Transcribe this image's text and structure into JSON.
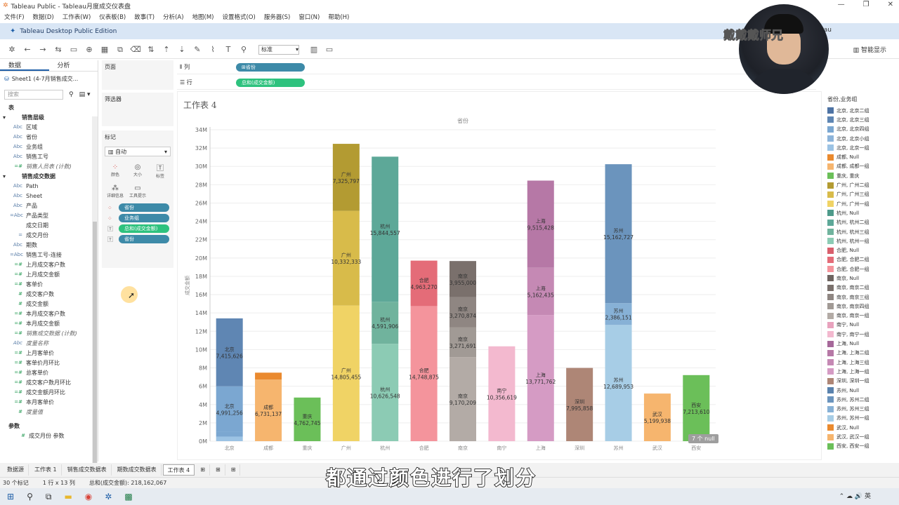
{
  "window": {
    "title": "Tableau Public - Tableau月度成交仪表盘"
  },
  "menu": [
    "文件(F)",
    "数据(D)",
    "工作表(W)",
    "仪表板(B)",
    "故事(T)",
    "分析(A)",
    "地图(M)",
    "设置格式(O)",
    "服务器(S)",
    "窗口(N)",
    "帮助(H)"
  ],
  "edition": "Tableau Desktop Public Edition",
  "signin": "Tableau",
  "toolbar": {
    "fit": "标准",
    "smart_show": "智能显示"
  },
  "left": {
    "tabs": [
      "数据",
      "分析"
    ],
    "datasource": "Sheet1 (4-7月销售成交...",
    "search_placeholder": "搜索",
    "table_header": "表",
    "fields": [
      {
        "type": "",
        "label": "销售层级",
        "group": true
      },
      {
        "type": "Abc",
        "label": "区域"
      },
      {
        "type": "Abc",
        "label": "省份"
      },
      {
        "type": "Abc",
        "label": "业务组"
      },
      {
        "type": "Abc",
        "label": "销售工号"
      },
      {
        "type": "=#",
        "label": "销售人员表 (计数)",
        "italic": true
      },
      {
        "type": "",
        "label": "销售成交数据",
        "group": true
      },
      {
        "type": "Abc",
        "label": "Path"
      },
      {
        "type": "Abc",
        "label": "Sheet"
      },
      {
        "type": "Abc",
        "label": "产品"
      },
      {
        "type": "=Abc",
        "label": "产品类型"
      },
      {
        "type": "",
        "label": "成交日期"
      },
      {
        "type": "=",
        "label": "成交月份"
      },
      {
        "type": "Abc",
        "label": "期数"
      },
      {
        "type": "=Abc",
        "label": "销售工号-连接"
      },
      {
        "type": "=#",
        "label": "上月成交客户数"
      },
      {
        "type": "=#",
        "label": "上月成交金额"
      },
      {
        "type": "=#",
        "label": "客单价"
      },
      {
        "type": "#",
        "label": "成交客户数"
      },
      {
        "type": "#",
        "label": "成交金额"
      },
      {
        "type": "=#",
        "label": "本月成交客户数"
      },
      {
        "type": "=#",
        "label": "本月成交金额"
      },
      {
        "type": "=#",
        "label": "销售成交数据 (计数)",
        "italic": true
      },
      {
        "type": "Abc",
        "label": "度量名称",
        "italic": true
      },
      {
        "type": "=#",
        "label": "上月客单价"
      },
      {
        "type": "=#",
        "label": "客单价月环比"
      },
      {
        "type": "=#",
        "label": "总客单价"
      },
      {
        "type": "=#",
        "label": "成交客户数月环比"
      },
      {
        "type": "=#",
        "label": "成交金额月环比"
      },
      {
        "type": "=#",
        "label": "本月客单价"
      },
      {
        "type": "#",
        "label": "度量值",
        "italic": true
      }
    ],
    "params_header": "参数",
    "param": "成交月份 参数"
  },
  "cards": {
    "pages": "页面",
    "filters": "筛选器",
    "marks": "标记",
    "mark_type": "自动",
    "buttons": [
      "颜色",
      "大小",
      "标签",
      "详细信息",
      "工具提示"
    ],
    "pills": [
      {
        "label": "省份",
        "kind": "blue",
        "icon": "color"
      },
      {
        "label": "业务组",
        "kind": "blue",
        "icon": "color"
      },
      {
        "label": "总和(成交金额)",
        "kind": "green",
        "icon": "label"
      },
      {
        "label": "省份",
        "kind": "blue",
        "icon": "label"
      }
    ]
  },
  "shelves": {
    "columns_label": "列",
    "columns_pill": "省份",
    "rows_label": "行",
    "rows_pill": "总和(成交金额)"
  },
  "view": {
    "title": "工作表 4",
    "null_badge": "7 个 null"
  },
  "chart_data": {
    "type": "bar",
    "stacked": true,
    "title": "",
    "xlabel": "省份",
    "ylabel": "成交金额",
    "ylim": [
      0,
      34000000
    ],
    "yticks": [
      "0M",
      "2M",
      "4M",
      "6M",
      "8M",
      "10M",
      "12M",
      "14M",
      "16M",
      "18M",
      "20M",
      "22M",
      "24M",
      "26M",
      "28M",
      "30M",
      "32M",
      "34M"
    ],
    "categories": [
      "北京",
      "成都",
      "重庆",
      "广州",
      "杭州",
      "合肥",
      "南京",
      "南宁",
      "上海",
      "深圳",
      "苏州",
      "武汉",
      "西安"
    ],
    "bars": [
      {
        "category": "北京",
        "segments": [
          {
            "value": 500000,
            "color": "#9cc3e4"
          },
          {
            "value": 500000,
            "color": "#7ba7d1"
          },
          {
            "value": 4991256,
            "color": "#7ba7d1",
            "label": "北京\n4,991,256"
          },
          {
            "value": 7415626,
            "color": "#5f86b3",
            "label": "北京\n7,415,626"
          }
        ]
      },
      {
        "category": "成都",
        "segments": [
          {
            "value": 6731137,
            "color": "#f6b56e",
            "label": "成都\n6,731,137"
          },
          {
            "value": 750000,
            "color": "#ea8a2f"
          }
        ]
      },
      {
        "category": "重庆",
        "segments": [
          {
            "value": 4762745,
            "color": "#6bbf59",
            "label": "重庆\n4,762,745"
          }
        ]
      },
      {
        "category": "广州",
        "segments": [
          {
            "value": 14805455,
            "color": "#f0d365",
            "label": "广州\n14,805,455"
          },
          {
            "value": 10332333,
            "color": "#d8bb4a",
            "label": "广州\n10,332,333"
          },
          {
            "value": 7325797,
            "color": "#b39b32",
            "label": "广州\n7,325,797"
          }
        ]
      },
      {
        "category": "杭州",
        "segments": [
          {
            "value": 10626548,
            "color": "#8ccbb4",
            "label": "杭州\n10,626,548"
          },
          {
            "value": 4591906,
            "color": "#70b39d",
            "label": "杭州\n4,591,906"
          },
          {
            "value": 15844557,
            "color": "#5da898",
            "label": "杭州\n15,844,557"
          }
        ]
      },
      {
        "category": "合肥",
        "segments": [
          {
            "value": 14748875,
            "color": "#f4949c",
            "label": "合肥\n14,748,875"
          },
          {
            "value": 4963270,
            "color": "#e46c78",
            "label": "合肥\n4,963,270"
          }
        ]
      },
      {
        "category": "南京",
        "segments": [
          {
            "value": 9170209,
            "color": "#b3aba6",
            "label": "南京\n9,170,209"
          },
          {
            "value": 3271691,
            "color": "#a19a95",
            "label": "南京\n3,271,691"
          },
          {
            "value": 3270874,
            "color": "#8f8682",
            "label": "南京\n3,270,874"
          },
          {
            "value": 3955000,
            "color": "#7a706c",
            "label": "南京\n3,955,000"
          }
        ]
      },
      {
        "category": "南宁",
        "segments": [
          {
            "value": 10356619,
            "color": "#f3b9cf",
            "label": "南宁\n10,356,619"
          }
        ]
      },
      {
        "category": "上海",
        "segments": [
          {
            "value": 13771762,
            "color": "#d59bc4",
            "label": "上海\n13,771,762"
          },
          {
            "value": 5162435,
            "color": "#c589b4",
            "label": "上海\n5,162,435"
          },
          {
            "value": 9515428,
            "color": "#b678a6",
            "label": "上海\n9,515,428"
          }
        ]
      },
      {
        "category": "深圳",
        "segments": [
          {
            "value": 7995858,
            "color": "#ae8676",
            "label": "深圳\n7,995,858"
          }
        ]
      },
      {
        "category": "苏州",
        "segments": [
          {
            "value": 12689953,
            "color": "#a7cde6",
            "label": "苏州\n12,689,953"
          },
          {
            "value": 2386151,
            "color": "#87b1d6",
            "label": "苏州\n2,386,151"
          },
          {
            "value": 15162727,
            "color": "#6b94bd",
            "label": "苏州\n15,162,727"
          }
        ]
      },
      {
        "category": "武汉",
        "segments": [
          {
            "value": 5199938,
            "color": "#f6b56e",
            "label": "武汉\n5,199,938"
          }
        ]
      },
      {
        "category": "西安",
        "segments": [
          {
            "value": 7213610,
            "color": "#6bbf59",
            "label": "西安\n7,213,610"
          }
        ]
      }
    ],
    "legend": {
      "title": "省份,业务组",
      "items": [
        {
          "label": "北京, 北京二组",
          "color": "#4e73a4"
        },
        {
          "label": "北京, 北京三组",
          "color": "#5f86b3"
        },
        {
          "label": "北京, 北京四组",
          "color": "#7ba7d1"
        },
        {
          "label": "北京, 北京小组",
          "color": "#8db4da"
        },
        {
          "label": "北京, 北京一组",
          "color": "#9cc3e4"
        },
        {
          "label": "成都, Null",
          "color": "#ea8a2f"
        },
        {
          "label": "成都, 成都一组",
          "color": "#f6b56e"
        },
        {
          "label": "重庆, 重庆",
          "color": "#6bbf59"
        },
        {
          "label": "广州, 广州二组",
          "color": "#b39b32"
        },
        {
          "label": "广州, 广州三组",
          "color": "#d8bb4a"
        },
        {
          "label": "广州, 广州一组",
          "color": "#f0d365"
        },
        {
          "label": "杭州, Null",
          "color": "#4e9a8a"
        },
        {
          "label": "杭州, 杭州二组",
          "color": "#5da898"
        },
        {
          "label": "杭州, 杭州三组",
          "color": "#70b39d"
        },
        {
          "label": "杭州, 杭州一组",
          "color": "#8ccbb4"
        },
        {
          "label": "合肥, Null",
          "color": "#d95f6c"
        },
        {
          "label": "合肥, 合肥二组",
          "color": "#e46c78"
        },
        {
          "label": "合肥, 合肥一组",
          "color": "#f4949c"
        },
        {
          "label": "南京, Null",
          "color": "#6e6460"
        },
        {
          "label": "南京, 南京二组",
          "color": "#7a706c"
        },
        {
          "label": "南京, 南京三组",
          "color": "#8f8682"
        },
        {
          "label": "南京, 南京四组",
          "color": "#a19a95"
        },
        {
          "label": "南京, 南京一组",
          "color": "#b3aba6"
        },
        {
          "label": "南宁, Null",
          "color": "#e8a2bd"
        },
        {
          "label": "南宁, 南宁一组",
          "color": "#f3b9cf"
        },
        {
          "label": "上海, Null",
          "color": "#a6689a"
        },
        {
          "label": "上海, 上海二组",
          "color": "#b678a6"
        },
        {
          "label": "上海, 上海三组",
          "color": "#c589b4"
        },
        {
          "label": "上海, 上海一组",
          "color": "#d59bc4"
        },
        {
          "label": "深圳, 深圳一组",
          "color": "#ae8676"
        },
        {
          "label": "苏州, Null",
          "color": "#5a82ad"
        },
        {
          "label": "苏州, 苏州二组",
          "color": "#6b94bd"
        },
        {
          "label": "苏州, 苏州三组",
          "color": "#87b1d6"
        },
        {
          "label": "苏州, 苏州一组",
          "color": "#a7cde6"
        },
        {
          "label": "武汉, Null",
          "color": "#ea8a2f"
        },
        {
          "label": "武汉, 武汉一组",
          "color": "#f6b56e"
        },
        {
          "label": "西安, 西安一组",
          "color": "#6bbf59"
        }
      ]
    }
  },
  "sheet_tabs": [
    "数据源",
    "工作表 1",
    "销售成交数据表",
    "期数成交数据表",
    "工作表 4"
  ],
  "status": {
    "marks": "30 个标记",
    "dims": "1 行 x 13 列",
    "sum": "总和(成交金额): 218,162,067"
  },
  "subtitle": "都通过颜色进行了划分",
  "watermark": "戴戴戴师兄",
  "tray": {
    "lang": "英"
  }
}
